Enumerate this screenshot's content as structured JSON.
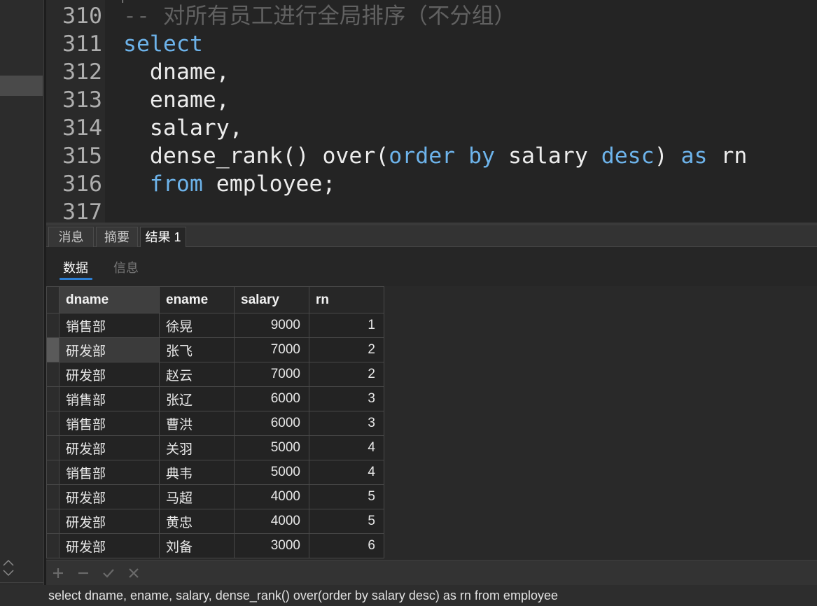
{
  "colors": {
    "keyword": "#6db3ea",
    "comment": "#616161",
    "accent": "#2d7fd3"
  },
  "editor": {
    "lines": [
      {
        "number": "310",
        "tokens": [
          "-- 对所有员工进行全局排序（不分组）"
        ]
      },
      {
        "number": "311",
        "tokens": [
          "select"
        ]
      },
      {
        "number": "312",
        "tokens": [
          "dname,"
        ]
      },
      {
        "number": "313",
        "tokens": [
          "ename,"
        ]
      },
      {
        "number": "314",
        "tokens": [
          "salary,"
        ]
      },
      {
        "number": "315",
        "tokens": [
          "dense_rank() over(",
          "order",
          " by",
          " salary ",
          "desc",
          ") ",
          "as",
          " rn"
        ]
      },
      {
        "number": "316",
        "tokens": [
          "from",
          " employee;"
        ]
      },
      {
        "number": "317",
        "tokens": []
      }
    ]
  },
  "result_tabs": [
    "消息",
    "摘要",
    "结果 1"
  ],
  "sub_tabs": [
    "数据",
    "信息"
  ],
  "results": {
    "columns": [
      "dname",
      "ename",
      "salary",
      "rn"
    ],
    "rows": [
      [
        "销售部",
        "徐晃",
        9000,
        1
      ],
      [
        "研发部",
        "张飞",
        7000,
        2
      ],
      [
        "研发部",
        "赵云",
        7000,
        2
      ],
      [
        "销售部",
        "张辽",
        6000,
        3
      ],
      [
        "销售部",
        "曹洪",
        6000,
        3
      ],
      [
        "研发部",
        "关羽",
        5000,
        4
      ],
      [
        "销售部",
        "典韦",
        5000,
        4
      ],
      [
        "研发部",
        "马超",
        4000,
        5
      ],
      [
        "研发部",
        "黄忠",
        4000,
        5
      ],
      [
        "研发部",
        "刘备",
        3000,
        6
      ]
    ]
  },
  "toolbar": {
    "icons": [
      "plus-icon",
      "minus-icon",
      "check-icon",
      "close-icon"
    ]
  },
  "status_bar": {
    "sql": "select dname, ename, salary, dense_rank() over(order by salary desc) as rn from employee"
  }
}
